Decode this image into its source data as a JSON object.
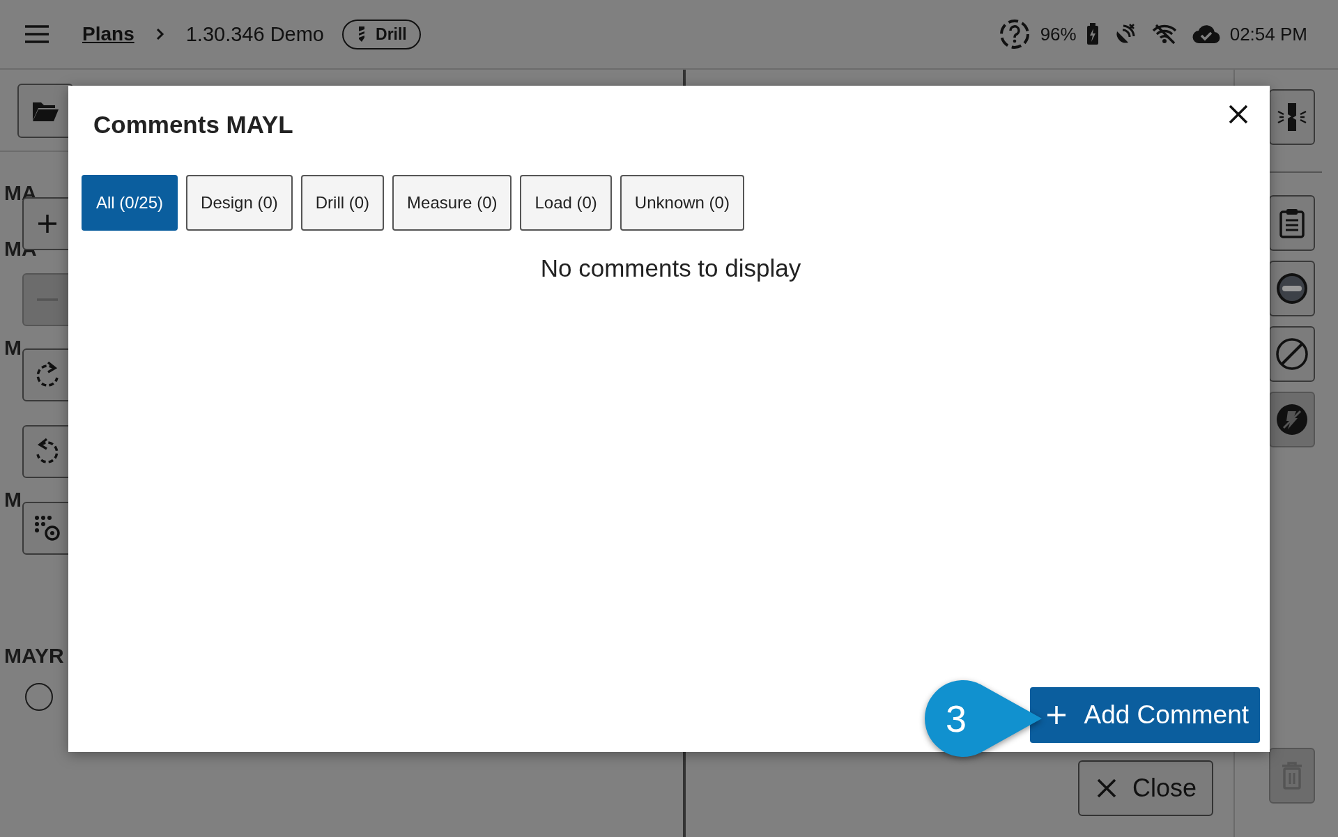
{
  "header": {
    "breadcrumb_link": "Plans",
    "plan_name": "1.30.346 Demo",
    "mode_chip": "Drill",
    "battery": "96%",
    "time": "02:54 PM"
  },
  "left_panel": {
    "labels": [
      "MA",
      "MA",
      "M",
      "M",
      "MAYR"
    ],
    "radio": {
      "checked": false
    },
    "tools": [
      {
        "kind": "folder",
        "disabled": false
      },
      {
        "kind": "add",
        "disabled": false
      },
      {
        "kind": "remove",
        "disabled": true
      },
      {
        "kind": "rotate-cw",
        "disabled": false
      },
      {
        "kind": "rotate-ccw",
        "disabled": false
      },
      {
        "kind": "grid-target",
        "disabled": false
      }
    ]
  },
  "right_panel": {
    "tools": [
      {
        "kind": "break",
        "disabled": false
      },
      {
        "kind": "clipboard",
        "disabled": false
      },
      {
        "kind": "minus-circle",
        "disabled": false
      },
      {
        "kind": "slash-circle",
        "disabled": false
      },
      {
        "kind": "no-fire",
        "disabled": true
      }
    ],
    "trash": {
      "disabled": true
    }
  },
  "close_button": "Close",
  "modal": {
    "title": "Comments MAYL",
    "tabs": [
      {
        "label": "All (0/25)",
        "selected": true
      },
      {
        "label": "Design (0)",
        "selected": false
      },
      {
        "label": "Drill (0)",
        "selected": false
      },
      {
        "label": "Measure (0)",
        "selected": false
      },
      {
        "label": "Load (0)",
        "selected": false
      },
      {
        "label": "Unknown (0)",
        "selected": false
      }
    ],
    "empty_message": "No comments to display",
    "add_button": "Add Comment",
    "callout": "3"
  }
}
